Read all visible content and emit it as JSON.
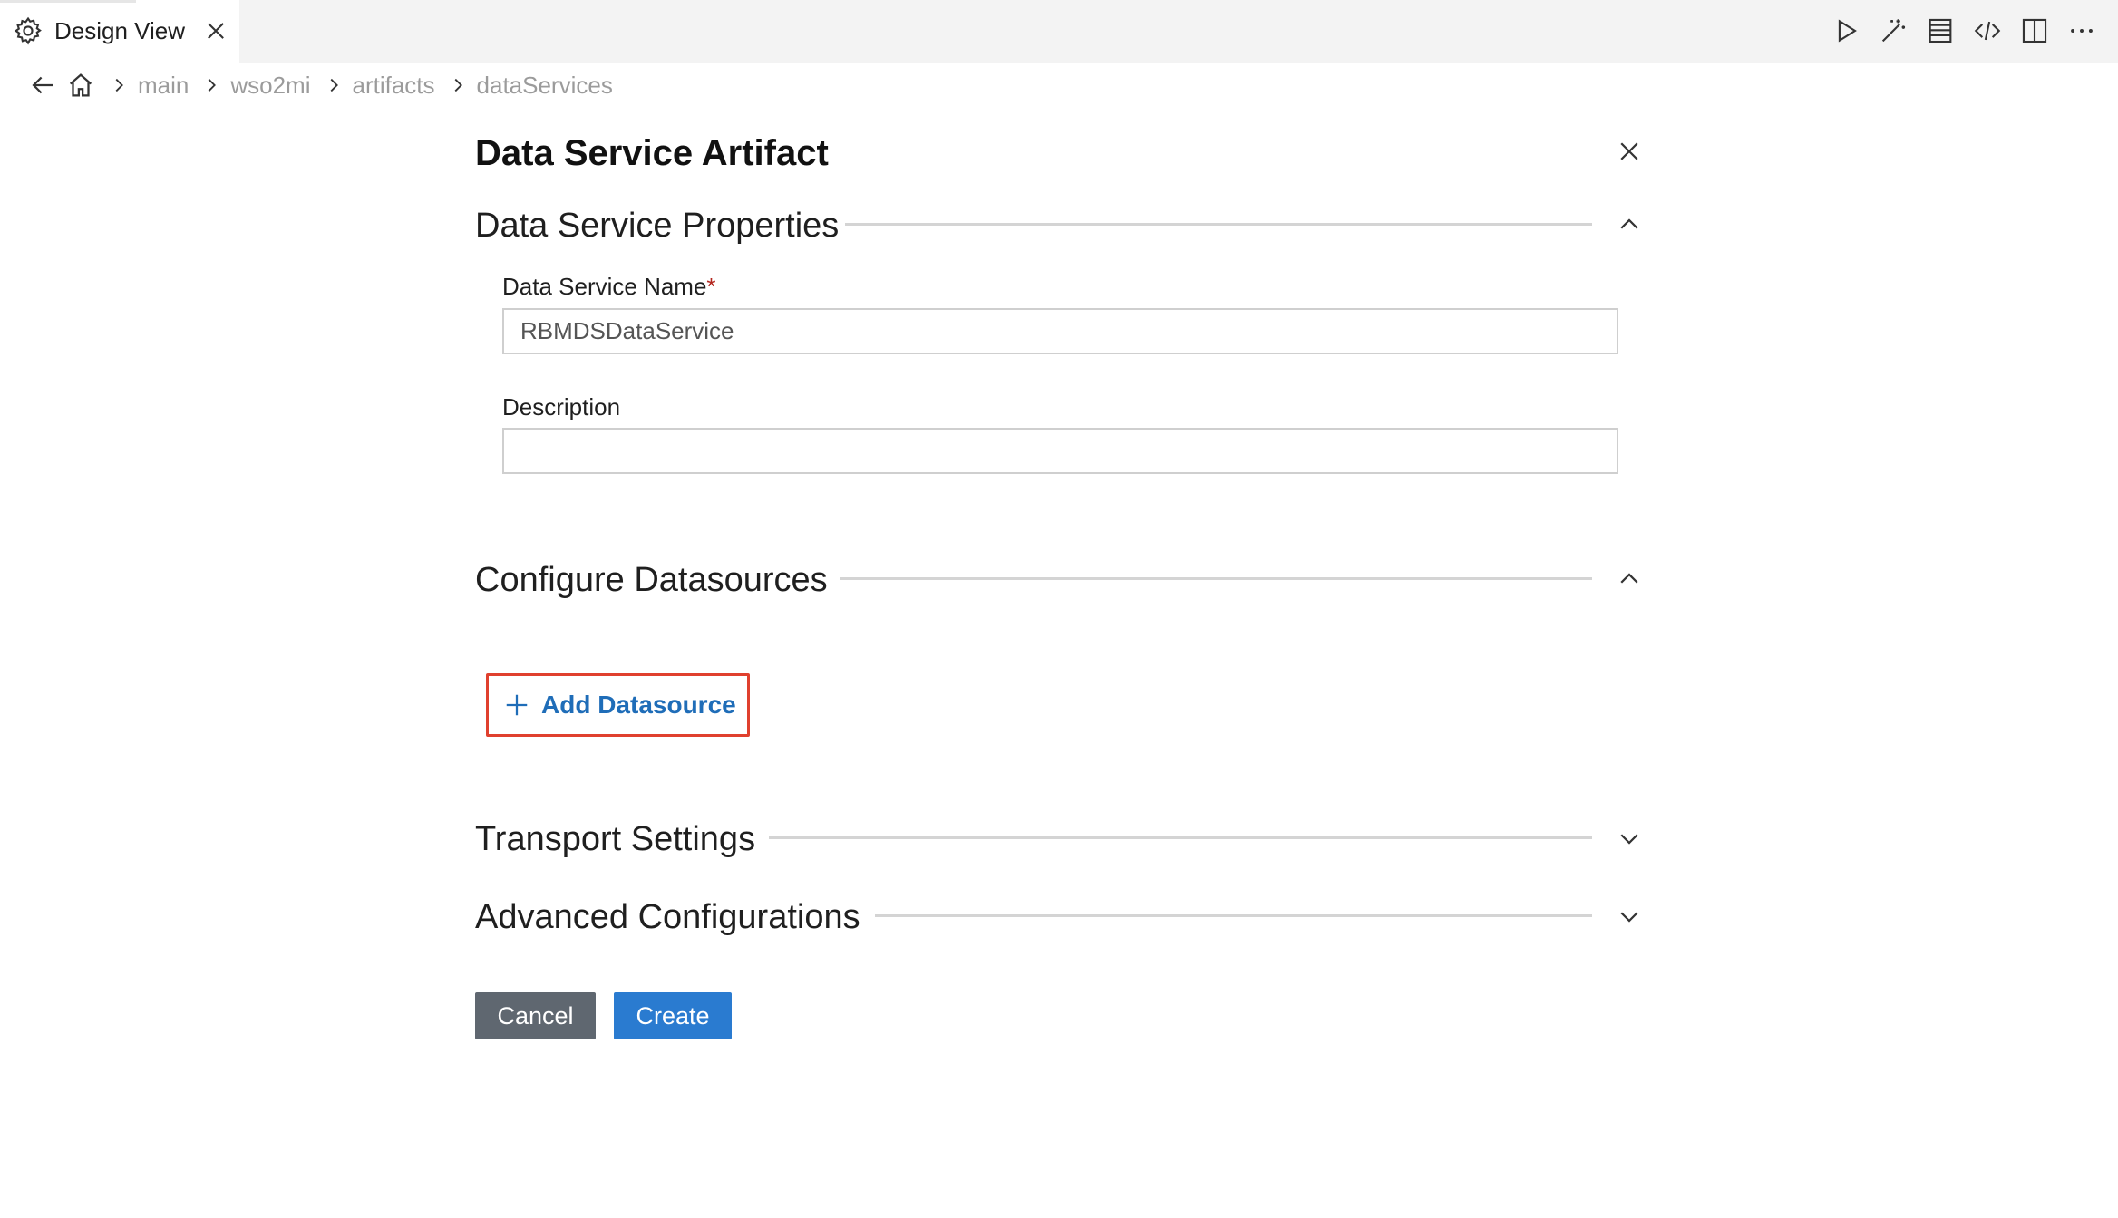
{
  "tab": {
    "title": "Design View",
    "icon": "gear-icon",
    "close_icon": "close-icon"
  },
  "toolbar": {
    "icons": [
      "run-icon",
      "magic-wand-icon",
      "list-icon",
      "code-icon",
      "split-editor-icon",
      "more-icon"
    ]
  },
  "breadcrumb": {
    "items": [
      "main",
      "wso2mi",
      "artifacts",
      "dataServices"
    ]
  },
  "form": {
    "title": "Data Service Artifact",
    "sections": {
      "properties": "Data Service Properties",
      "datasources": "Configure Datasources",
      "transport": "Transport Settings",
      "advanced": "Advanced Configurations"
    },
    "fields": {
      "name_label": "Data Service Name",
      "name_required_mark": "*",
      "name_value": "RBMDSDataService",
      "description_label": "Description",
      "description_value": ""
    },
    "add_datasource_label": "Add Datasource",
    "cancel_label": "Cancel",
    "create_label": "Create"
  },
  "colors": {
    "accent": "#2a7bd0",
    "link": "#1f6db8",
    "highlight_border": "#e0402e",
    "cancel_bg": "#5f6770",
    "required": "#b3261e"
  }
}
